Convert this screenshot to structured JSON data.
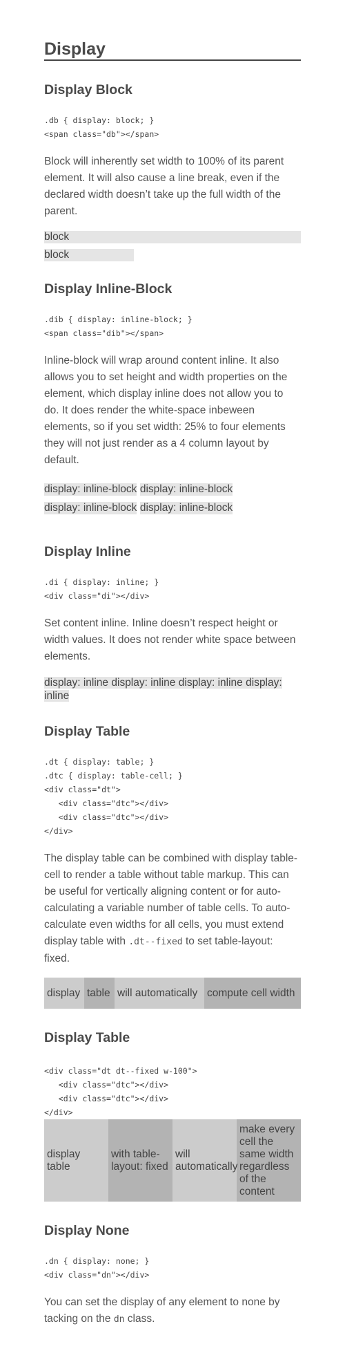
{
  "title": "Display",
  "sections": {
    "block": {
      "heading": "Display Block",
      "code": [
        ".db { display: block; }",
        "<span class=\"db\"></span>"
      ],
      "text": "Block will inherently set width to 100% of its parent element. It will also cause a line break, even if the declared width doesn’t take up the full width of the parent.",
      "examples": [
        "block",
        "block"
      ]
    },
    "inline_block": {
      "heading": "Display Inline-Block",
      "code": [
        ".dib { display: inline-block; }",
        "<span class=\"dib\"></span>"
      ],
      "text": "Inline-block will wrap around content inline. It also allows you to set height and width properties on the element, which display inline does not allow you to do. It does render the white-space inbeween elements, so if you set width: 25% to four elements they will not just render as a 4 column layout by default.",
      "examples": [
        "display: inline-block",
        "display: inline-block",
        "display: inline-block",
        "display: inline-block"
      ]
    },
    "inline": {
      "heading": "Display Inline",
      "code": [
        ".di { display: inline; }",
        "<div class=\"di\"></div>"
      ],
      "text": "Set content inline. Inline doesn’t respect height or width values. It does not render white space between elements.",
      "examples": [
        "display: inline",
        "display: inline",
        "display: inline",
        "display: inline"
      ]
    },
    "table": {
      "heading": "Display Table",
      "code": [
        ".dt { display: table; }",
        ".dtc { display: table-cell; }",
        "<div class=\"dt\">",
        "   <div class=\"dtc\"></div>",
        "   <div class=\"dtc\"></div>",
        "</div>"
      ],
      "text_before": "The display table can be combined with display table-cell to render a table without table markup. This can be useful for vertically aligning content or for auto-calculating a variable number of table cells. To auto-calculate even widths for all cells, you must extend display table with",
      "text_code": ".dt--fixed",
      "text_after": "to set table-layout: fixed.",
      "cells": [
        "display",
        "table",
        "will automatically",
        "compute cell width"
      ]
    },
    "table_fixed": {
      "heading": "Display Table",
      "code": [
        "<div class=\"dt dt--fixed w-100\">",
        "   <div class=\"dtc\"></div>",
        "   <div class=\"dtc\"></div>",
        "</div>"
      ],
      "cells": [
        "display table",
        "with table-layout: fixed",
        "will automatically",
        "make every cell the same width regardless of the content"
      ]
    },
    "none": {
      "heading": "Display None",
      "code": [
        ".dn { display: none; }",
        "<div class=\"dn\"></div>"
      ],
      "text_before": "You can set the display of any element to none by tacking on the",
      "text_code": "dn",
      "text_after": "class."
    }
  }
}
